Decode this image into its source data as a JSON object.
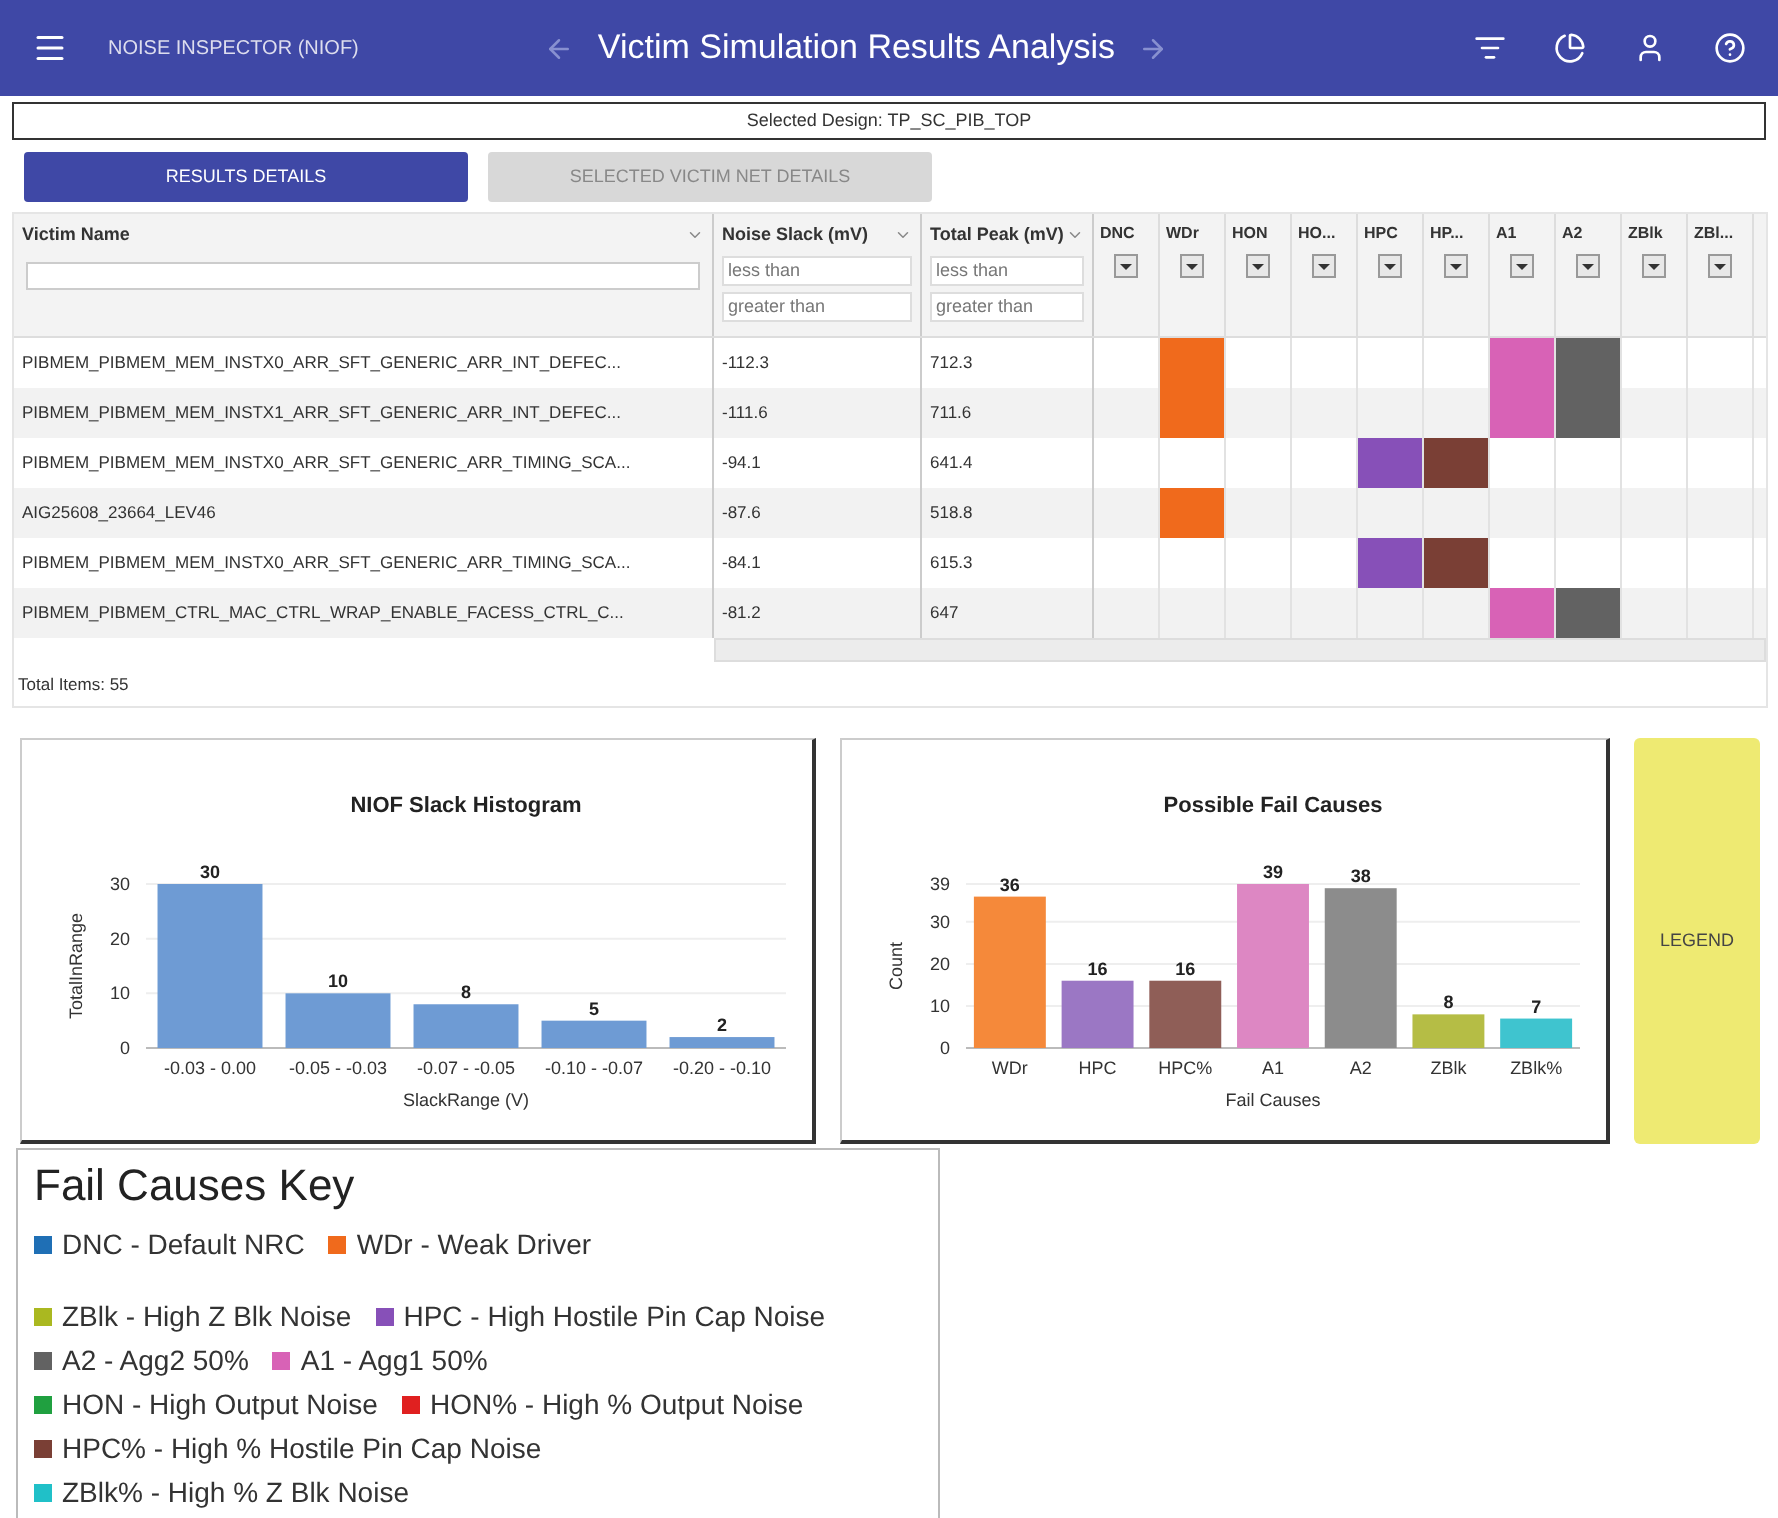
{
  "app_bar": {
    "app_name": "NOISE INSPECTOR (NIOF)",
    "title": "Victim Simulation Results Analysis"
  },
  "selected_design": "Selected Design: TP_SC_PIB_TOP",
  "tabs": [
    {
      "label": "RESULTS DETAILS",
      "selected": true
    },
    {
      "label": "SELECTED VICTIM NET DETAILS",
      "selected": false
    }
  ],
  "table": {
    "columns": [
      {
        "label": "Victim Name",
        "kind": "text"
      },
      {
        "label": "Noise Slack (mV)",
        "kind": "range",
        "placeholder_low": "less than",
        "placeholder_high": "greater than"
      },
      {
        "label": "Total Peak (mV)",
        "kind": "range",
        "placeholder_low": "less than",
        "placeholder_high": "greater than"
      }
    ],
    "cause_columns": [
      {
        "label": "DNC"
      },
      {
        "label": "WDr",
        "color": "#f06a1c"
      },
      {
        "label": "HON"
      },
      {
        "label": "HO..."
      },
      {
        "label": "HPC",
        "color": "#8750b8"
      },
      {
        "label": "HP...",
        "color": "#7a3f35"
      },
      {
        "label": "A1",
        "color": "#d862b6"
      },
      {
        "label": "A2",
        "color": "#626262"
      },
      {
        "label": "ZBlk"
      },
      {
        "label": "ZBl..."
      }
    ],
    "rows": [
      {
        "name": "PIBMEM_PIBMEM_MEM_INSTX0_ARR_SFT_GENERIC_ARR_INT_DEFEC...",
        "slack": "-112.3",
        "peak": "712.3",
        "flags": [
          false,
          true,
          false,
          false,
          false,
          false,
          true,
          true,
          false,
          false
        ]
      },
      {
        "name": "PIBMEM_PIBMEM_MEM_INSTX1_ARR_SFT_GENERIC_ARR_INT_DEFEC...",
        "slack": "-111.6",
        "peak": "711.6",
        "flags": [
          false,
          true,
          false,
          false,
          false,
          false,
          true,
          true,
          false,
          false
        ]
      },
      {
        "name": "PIBMEM_PIBMEM_MEM_INSTX0_ARR_SFT_GENERIC_ARR_TIMING_SCA...",
        "slack": "-94.1",
        "peak": "641.4",
        "flags": [
          false,
          false,
          false,
          false,
          true,
          true,
          false,
          false,
          false,
          false
        ]
      },
      {
        "name": "AIG25608_23664_LEV46",
        "slack": "-87.6",
        "peak": "518.8",
        "flags": [
          false,
          true,
          false,
          false,
          false,
          false,
          false,
          false,
          false,
          false
        ]
      },
      {
        "name": "PIBMEM_PIBMEM_MEM_INSTX0_ARR_SFT_GENERIC_ARR_TIMING_SCA...",
        "slack": "-84.1",
        "peak": "615.3",
        "flags": [
          false,
          false,
          false,
          false,
          true,
          true,
          false,
          false,
          false,
          false
        ]
      },
      {
        "name": "PIBMEM_PIBMEM_CTRL_MAC_CTRL_WRAP_ENABLE_FACESS_CTRL_C...",
        "slack": "-81.2",
        "peak": "647",
        "flags": [
          false,
          false,
          false,
          false,
          false,
          false,
          true,
          true,
          false,
          false
        ]
      }
    ],
    "total_items": "Total Items: 55"
  },
  "histogram": {
    "chart_data": {
      "type": "bar",
      "title": "NIOF Slack Histogram",
      "xlabel": "SlackRange (V)",
      "ylabel": "TotalInRange",
      "categories": [
        "-0.03 - 0.00",
        "-0.05 - -0.03",
        "-0.07 - -0.05",
        "-0.10 - -0.07",
        "-0.20 - -0.10"
      ],
      "series": [
        {
          "color": "#6e9bd4",
          "values": [
            30,
            10,
            8,
            5,
            2
          ]
        }
      ],
      "ylim": [
        0,
        30
      ],
      "yticks": [
        0,
        10,
        20,
        30
      ],
      "grid": true,
      "data_labels": true
    }
  },
  "fail_causes": {
    "chart_data": {
      "type": "bar",
      "title": "Possible Fail Causes",
      "xlabel": "Fail Causes",
      "ylabel": "Count",
      "stacked": true,
      "series": [
        {
          "name": "WDr",
          "color": "#f5893a",
          "values": [
            36,
            null,
            null,
            null,
            null,
            null,
            null
          ]
        },
        {
          "name": "HPC",
          "color": "#9b77c4",
          "values": [
            null,
            16,
            null,
            null,
            null,
            null,
            null
          ]
        },
        {
          "name": "HPC%",
          "color": "#8f5e57",
          "values": [
            null,
            null,
            16,
            null,
            null,
            null,
            null
          ]
        },
        {
          "name": "A1",
          "color": "#dd87c3",
          "values": [
            null,
            null,
            null,
            39,
            null,
            null,
            null
          ]
        },
        {
          "name": "A2",
          "color": "#8c8c8c",
          "values": [
            null,
            null,
            null,
            null,
            38,
            null,
            null
          ]
        },
        {
          "name": "ZBlk",
          "color": "#b5bd45",
          "values": [
            null,
            null,
            null,
            null,
            null,
            8,
            null
          ]
        },
        {
          "name": "ZBlk%",
          "color": "#3fc4cf",
          "values": [
            null,
            null,
            null,
            null,
            null,
            null,
            7
          ]
        }
      ],
      "ylim": [
        0,
        39
      ],
      "yticks": [
        0,
        10,
        20,
        30,
        39
      ],
      "grid": true,
      "data_labels": true
    }
  },
  "legend_button": "LEGEND",
  "key": {
    "title": "Fail Causes Key",
    "lines": [
      [
        {
          "text": "DNC - Default NRC",
          "color": "#1f6fb5"
        },
        {
          "text": "WDr - Weak Driver",
          "color": "#f06a1c"
        }
      ],
      [
        {
          "text": "ZBlk - High Z Blk Noise",
          "color": "#aab820"
        },
        {
          "text": "HPC - High Hostile Pin Cap Noise",
          "color": "#8750b8"
        }
      ],
      [
        {
          "text": "A2 - Agg2 50%",
          "color": "#626262"
        },
        {
          "text": "A1 - Agg1 50%",
          "color": "#d862b6"
        }
      ],
      [
        {
          "text": "HON - High Output Noise",
          "color": "#20a040"
        },
        {
          "text": "HON% - High % Output Noise",
          "color": "#e02020"
        }
      ],
      [
        {
          "text": "HPC% - High % Hostile Pin Cap Noise",
          "color": "#7a3f35"
        }
      ],
      [
        {
          "text": "ZBlk% - High % Z Blk Noise",
          "color": "#20c0c8"
        }
      ]
    ]
  }
}
